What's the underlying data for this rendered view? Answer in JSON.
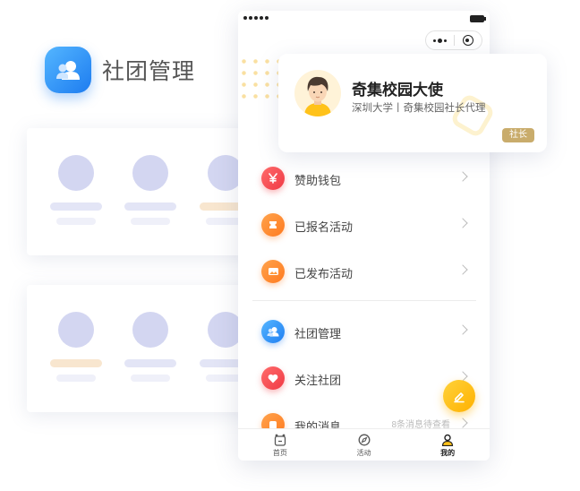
{
  "background": {
    "title": "社团管理"
  },
  "profile": {
    "name": "奇集校园大使",
    "subtitle": "深圳大学丨奇集校园社长代理",
    "role_badge": "社长"
  },
  "menu": {
    "items": [
      {
        "label": "赞助钱包",
        "icon": "yen-icon"
      },
      {
        "label": "已报名活动",
        "icon": "ticket-icon"
      },
      {
        "label": "已发布活动",
        "icon": "image-icon"
      },
      {
        "label": "社团管理",
        "icon": "club-icon"
      },
      {
        "label": "关注社团",
        "icon": "heart-icon"
      },
      {
        "label": "我的消息",
        "icon": "message-icon",
        "extra": "8条消息待查看"
      }
    ]
  },
  "tabbar": {
    "tabs": [
      {
        "label": "首页",
        "icon": "home-icon"
      },
      {
        "label": "活动",
        "icon": "compass-icon"
      },
      {
        "label": "我的",
        "icon": "profile-icon",
        "active": true
      }
    ]
  },
  "colors": {
    "accent_yellow": "#ffc21a",
    "badge_gold": "#c9ac6c",
    "icon_red": "#f03a45",
    "icon_orange": "#ff7a1f",
    "icon_blue": "#1f7ff2"
  }
}
